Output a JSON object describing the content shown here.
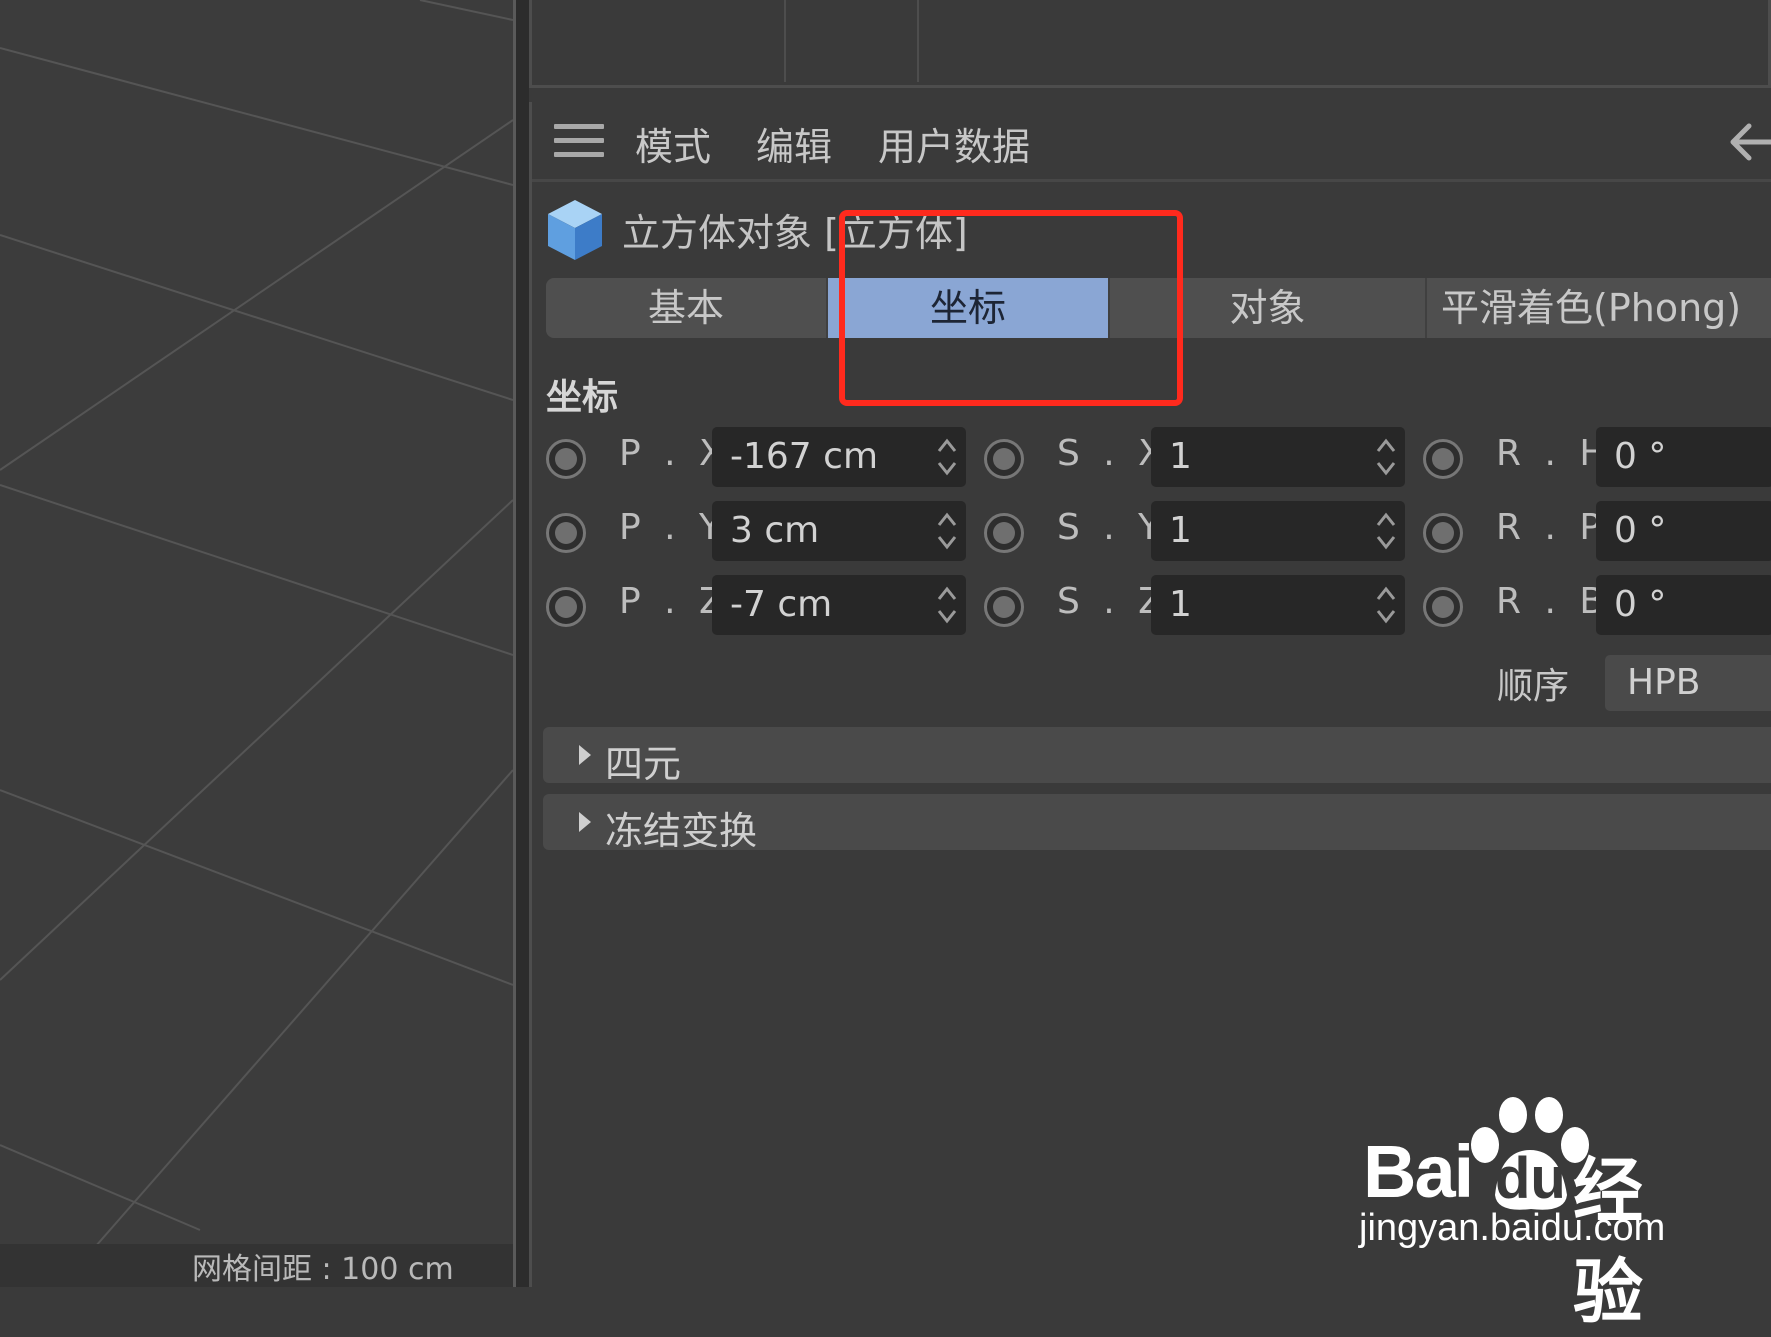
{
  "viewport": {
    "grid_label": "网格间距 : 100 cm"
  },
  "menubar": {
    "items": [
      "模式",
      "编辑",
      "用户数据"
    ]
  },
  "object": {
    "title": "立方体对象 [立方体]"
  },
  "tabs": [
    {
      "label": "基本",
      "active": false
    },
    {
      "label": "坐标",
      "active": true
    },
    {
      "label": "对象",
      "active": false
    },
    {
      "label": "平滑着色(Phong)",
      "active": false
    }
  ],
  "section": {
    "title": "坐标"
  },
  "coords": {
    "position": [
      {
        "label": "P . X",
        "value": "-167 cm"
      },
      {
        "label": "P . Y",
        "value": "3 cm"
      },
      {
        "label": "P . Z",
        "value": "-7 cm"
      }
    ],
    "scale": [
      {
        "label": "S . X",
        "value": "1"
      },
      {
        "label": "S . Y",
        "value": "1"
      },
      {
        "label": "S . Z",
        "value": "1"
      }
    ],
    "rotation": [
      {
        "label": "R . H",
        "value": "0 °"
      },
      {
        "label": "R . P",
        "value": "0 °"
      },
      {
        "label": "R . B",
        "value": "0 °"
      }
    ]
  },
  "order": {
    "label": "顺序",
    "value": "HPB"
  },
  "collapsibles": [
    "四元",
    "冻结变换"
  ],
  "watermark": {
    "brand_latin": "Bai",
    "brand_du": "du",
    "brand_cn": "经验",
    "url": "jingyan.baidu.com"
  },
  "colors": {
    "active_tab": "#8aa6d4",
    "highlight": "#ff2a1d",
    "panel_bg": "#3a3a3a"
  }
}
